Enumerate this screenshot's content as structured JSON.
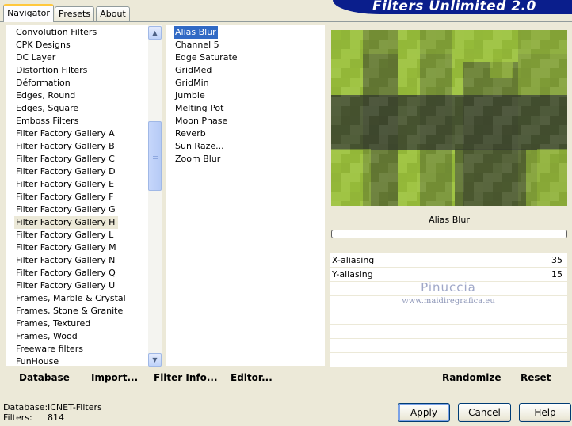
{
  "banner": {
    "title": "Filters Unlimited 2.0"
  },
  "tabs": [
    {
      "label": "Navigator",
      "active": true
    },
    {
      "label": "Presets",
      "active": false
    },
    {
      "label": "About",
      "active": false
    }
  ],
  "categories": {
    "items": [
      "Convolution Filters",
      "CPK Designs",
      "DC Layer",
      "Distortion Filters",
      "Déformation",
      "Edges, Round",
      "Edges, Square",
      "Emboss Filters",
      "Filter Factory Gallery A",
      "Filter Factory Gallery B",
      "Filter Factory Gallery C",
      "Filter Factory Gallery D",
      "Filter Factory Gallery E",
      "Filter Factory Gallery F",
      "Filter Factory Gallery G",
      "Filter Factory Gallery H",
      "Filter Factory Gallery L",
      "Filter Factory Gallery M",
      "Filter Factory Gallery N",
      "Filter Factory Gallery Q",
      "Filter Factory Gallery U",
      "Frames, Marble & Crystal",
      "Frames, Stone & Granite",
      "Frames, Textured",
      "Frames, Wood",
      "Freeware filters",
      "FunHouse"
    ],
    "selected": "Filter Factory Gallery H"
  },
  "filters": {
    "items": [
      "Alias Blur",
      "Channel 5",
      "Edge Saturate",
      "GridMed",
      "GridMin",
      "Jumble",
      "Melting Pot",
      "Moon Phase",
      "Reverb",
      "Sun Raze...",
      "Zoom Blur"
    ],
    "selected": "Alias Blur"
  },
  "left_toolbar": {
    "database": "Database",
    "import": "Import...",
    "filter_info": "Filter Info...",
    "editor": "Editor..."
  },
  "right_toolbar": {
    "randomize": "Randomize",
    "reset": "Reset"
  },
  "preview": {
    "filter_name": "Alias Blur",
    "progress": 0
  },
  "params": [
    {
      "name": "X-aliasing",
      "value": "35"
    },
    {
      "name": "Y-aliasing",
      "value": "15"
    }
  ],
  "watermark": {
    "name": "Pinuccia",
    "url": "www.maidiregrafica.eu"
  },
  "status": {
    "database_label": "Database:",
    "database_value": "ICNET-Filters",
    "filters_label": "Filters:",
    "filters_value": "814"
  },
  "buttons": {
    "apply": "Apply",
    "cancel": "Cancel",
    "help": "Help"
  },
  "colors": {
    "banner": "#0a1e8c",
    "selection": "#316ac5",
    "preview_light": "#9cc23c",
    "preview_dark": "#3c4430"
  }
}
